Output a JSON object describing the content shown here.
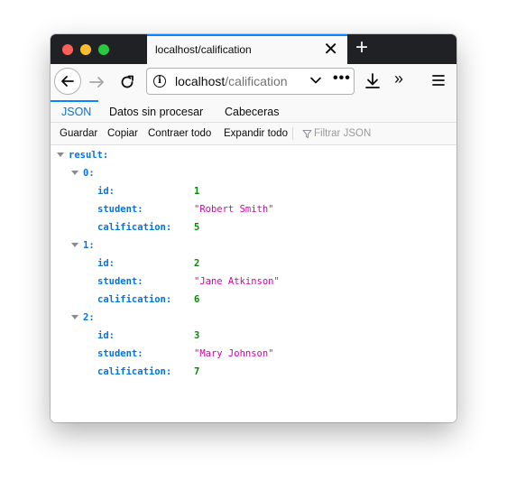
{
  "browser": {
    "tab_title": "localhost/calification",
    "close_glyph": "✕",
    "newtab_glyph": "+",
    "url_host": "localhost",
    "url_path": "/calification",
    "info_glyph": "i",
    "more_glyph": "•••",
    "overflow_glyph": "»"
  },
  "view_tabs": [
    "JSON",
    "Datos sin procesar",
    "Cabeceras"
  ],
  "toolbar": {
    "save": "Guardar",
    "copy": "Copiar",
    "collapse": "Contraer todo",
    "expand": "Expandir todo",
    "filter_placeholder": "Filtrar JSON"
  },
  "json": {
    "root_key": "result:",
    "items": [
      {
        "index": "0:",
        "id_key": "id:",
        "id": "1",
        "student_key": "student:",
        "student": "\"Robert Smith\"",
        "calif_key": "calification:",
        "calification": "5"
      },
      {
        "index": "1:",
        "id_key": "id:",
        "id": "2",
        "student_key": "student:",
        "student": "\"Jane Atkinson\"",
        "calif_key": "calification:",
        "calification": "6"
      },
      {
        "index": "2:",
        "id_key": "id:",
        "id": "3",
        "student_key": "student:",
        "student": "\"Mary Johnson\"",
        "calif_key": "calification:",
        "calification": "7"
      }
    ]
  },
  "colors": {
    "accent": "#0a84ff",
    "key": "#0074e8",
    "number": "#058b00",
    "string": "#dd00a9"
  }
}
